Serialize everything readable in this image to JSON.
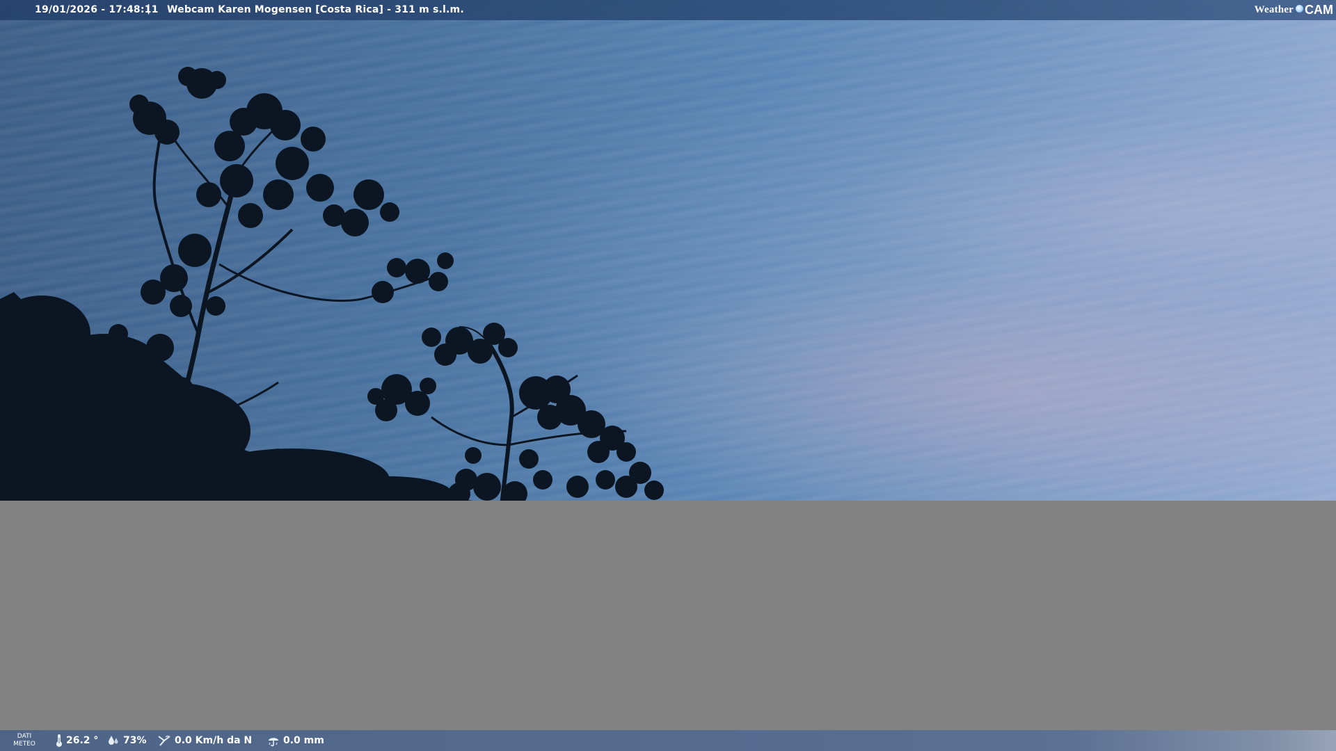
{
  "header": {
    "datetime": "19/01/2026 - 17:48:11",
    "separator": "|",
    "location": "Webcam Karen Mogensen [Costa Rica]  - 311 m s.l.m."
  },
  "logo": {
    "word": "Weather",
    "cam": "CAM"
  },
  "weather_bar": {
    "label_line1": "DATI",
    "label_line2": "METEO",
    "temperature": "26.2 °",
    "humidity": "73%",
    "wind": "0.0 Km/h da N",
    "rain": "0.0 mm"
  },
  "icons": {
    "temperature": "thermometer-icon",
    "humidity": "humidity-icon",
    "wind": "wind-icon",
    "rain": "rain-icon"
  },
  "colors": {
    "top_bar": "#2c4c78",
    "bottom_bar": "#566d90",
    "grey_block": "#828282",
    "sky_left": "#3a5c86",
    "sky_right": "#95acd2",
    "foliage": "#0c1622"
  }
}
